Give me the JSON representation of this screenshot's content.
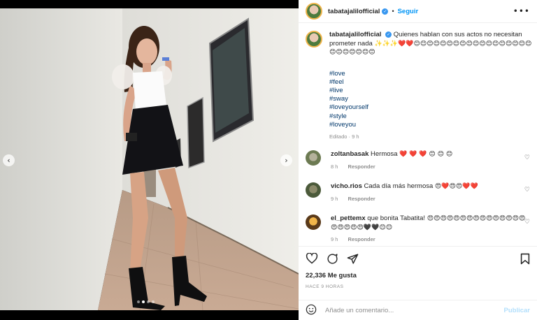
{
  "post": {
    "username": "tabatajalilofficial",
    "follow_label": "Seguir",
    "separator": "•",
    "more_icon": "more-horizontal-icon"
  },
  "caption": {
    "username": "tabatajalilofficial",
    "text": "Quienes hablan con sus actos no necesitan prometer nada",
    "emojis": "✨✨✨❤️❤️😊😊😊😊😊😊😊😊😊😊😊😊😊😊😊😊😊😊😊😊😊😊😊😊😊",
    "hashtags": [
      "#love",
      "#feel",
      "#live",
      "#sway",
      "#loveyourself",
      "#style",
      "#loveyou"
    ],
    "edited": "Editado",
    "edited_sep": "·",
    "edited_time": "9 h"
  },
  "comments": [
    {
      "username": "zoltanbasak",
      "text": "Hermosa",
      "emojis": "❤️ ❤️ ❤️ 😊 😊 😊",
      "time": "8 h",
      "reply": "Responder"
    },
    {
      "username": "vicho.rios",
      "text": "Cada día más hermosa",
      "emojis": "😍❤️😍😍❤️❤️",
      "time": "9 h",
      "reply": "Responder"
    },
    {
      "username": "el_pettemx",
      "text": "que bonita Tabatita!",
      "emojis": "😍😍😍😍😍😍😍😍😍😍😍😍😍😍😍😍😍😍😍😍🖤🖤😊😊",
      "time": "9 h",
      "reply": "Responder"
    }
  ],
  "actions": {
    "like_icon": "heart-icon",
    "comment_icon": "comment-icon",
    "share_icon": "share-icon",
    "save_icon": "bookmark-icon"
  },
  "likes": "22,336 Me gusta",
  "timeago": "HACE 9 HORAS",
  "add_comment": {
    "placeholder": "Añade un comentario...",
    "publish_label": "Publicar",
    "emoji_icon": "emoji-smiley-icon"
  },
  "carousel": {
    "prev_icon": "chevron-left-icon",
    "next_icon": "chevron-right-icon",
    "prev_glyph": "‹",
    "next_glyph": "›",
    "total_slides": 4,
    "active_slide": 2
  },
  "colors": {
    "link": "#00376b",
    "accent": "#0095f6",
    "muted": "#8e8e8e",
    "text": "#262626"
  }
}
